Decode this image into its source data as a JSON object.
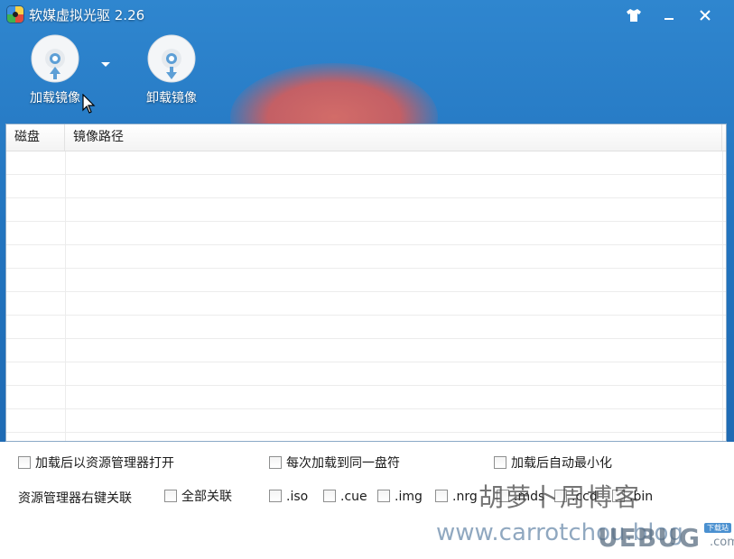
{
  "window": {
    "title": "软媒虚拟光驱 2.26"
  },
  "toolbar": {
    "mount_label": "加载镜像",
    "unmount_label": "卸载镜像"
  },
  "list": {
    "columns": [
      "磁盘",
      "镜像路径"
    ],
    "rows": []
  },
  "options": {
    "open_explorer_after_mount": {
      "label": "加载后以资源管理器打开",
      "checked": false
    },
    "same_drive_letter": {
      "label": "每次加载到同一盘符",
      "checked": false
    },
    "minimize_after_mount": {
      "label": "加载后自动最小化",
      "checked": false
    },
    "context_menu_label": "资源管理器右键关联",
    "associate_all": {
      "label": "全部关联",
      "checked": false
    },
    "formats": [
      {
        "label": ".iso",
        "checked": false
      },
      {
        "label": ".cue",
        "checked": false
      },
      {
        "label": ".img",
        "checked": false
      },
      {
        "label": ".nrg",
        "checked": false
      },
      {
        "label": ".mds",
        "checked": false
      },
      {
        "label": ".ccd",
        "checked": false
      },
      {
        "label": ".bin",
        "checked": false
      }
    ]
  },
  "watermarks": {
    "chinese": "胡萝卜周博客",
    "url": "www.carrotchou.blog",
    "logo": "UEBUG",
    "logo_suffix": ".com",
    "logo_badge": "下载站"
  },
  "colors": {
    "titlebar_blue": "#2f86cf",
    "accent_red": "#e56a5e"
  },
  "icons": {
    "skin": "tshirt-icon",
    "minimize": "minimize-icon",
    "close": "close-icon",
    "mount": "disc-mount-icon",
    "unmount": "disc-unmount-icon",
    "dropdown": "chevron-down-icon",
    "cursor": "mouse-cursor-icon"
  }
}
